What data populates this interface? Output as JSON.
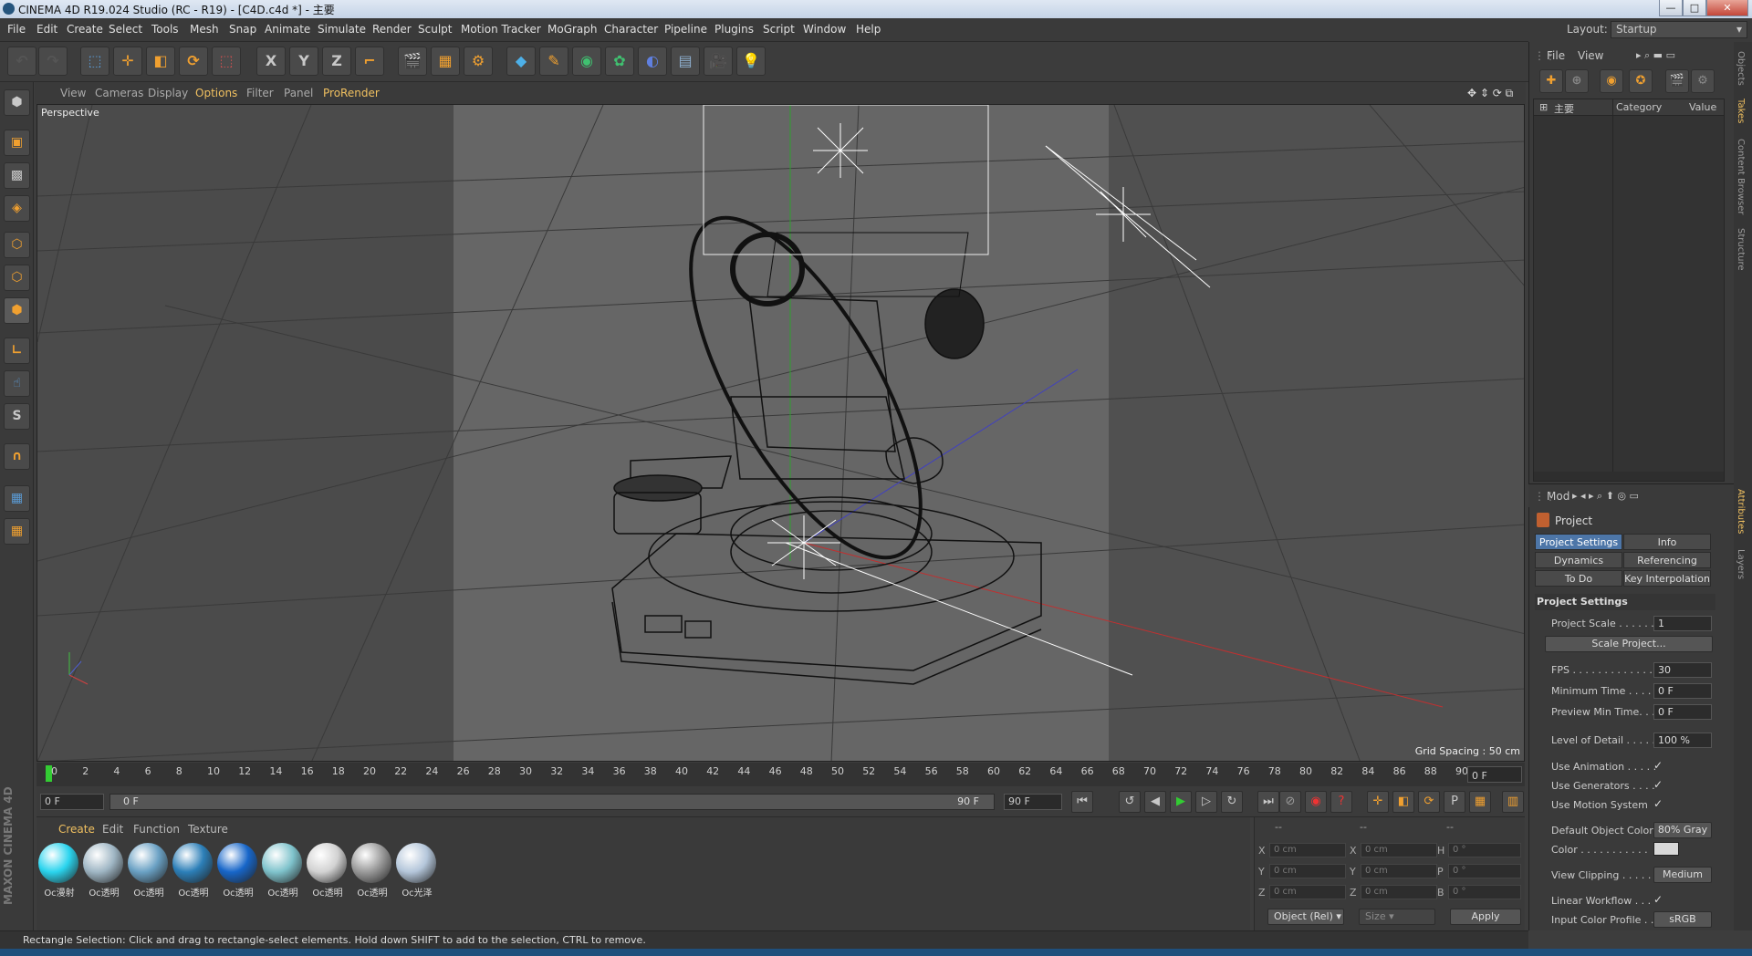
{
  "window": {
    "title": "CINEMA 4D R19.024 Studio (RC - R19) - [C4D.c4d *] - 主要",
    "controls": [
      "—",
      "□",
      "✕"
    ]
  },
  "menu": [
    "File",
    "Edit",
    "Create",
    "Select",
    "Tools",
    "Mesh",
    "Snap",
    "Animate",
    "Simulate",
    "Render",
    "Sculpt",
    "Motion Tracker",
    "MoGraph",
    "Character",
    "Pipeline",
    "Plugins",
    "Script",
    "Window",
    "Help"
  ],
  "layout": {
    "label": "Layout:",
    "value": "Startup"
  },
  "toolbar": {
    "axis_x": "X",
    "axis_y": "Y",
    "axis_z": "Z"
  },
  "viewport": {
    "menu": [
      "View",
      "Cameras",
      "Display",
      "Options",
      "Filter",
      "Panel",
      "ProRender"
    ],
    "camera_label": "Perspective",
    "grid_spacing": "Grid Spacing : 50 cm"
  },
  "timeline": {
    "ticks": [
      "0",
      "2",
      "4",
      "6",
      "8",
      "10",
      "12",
      "14",
      "16",
      "18",
      "20",
      "22",
      "24",
      "26",
      "28",
      "30",
      "32",
      "34",
      "36",
      "38",
      "40",
      "42",
      "44",
      "46",
      "48",
      "50",
      "52",
      "54",
      "56",
      "58",
      "60",
      "62",
      "64",
      "66",
      "68",
      "70",
      "72",
      "74",
      "76",
      "78",
      "80",
      "82",
      "84",
      "86",
      "88",
      "90"
    ],
    "current_frame": "0 F",
    "start_field": "0 F",
    "range_start": "0 F",
    "range_end": "90 F",
    "end_field": "90 F"
  },
  "materials": {
    "menu": [
      "Create",
      "Edit",
      "Function",
      "Texture"
    ],
    "items": [
      {
        "label": "Oc漫射",
        "color": "#2ad4ee"
      },
      {
        "label": "Oc透明",
        "color": "#9fb6c4"
      },
      {
        "label": "Oc透明",
        "color": "#6aa1c4"
      },
      {
        "label": "Oc透明",
        "color": "#2c7fb8"
      },
      {
        "label": "Oc透明",
        "color": "#1766c9"
      },
      {
        "label": "Oc透明",
        "color": "#7fc3cc"
      },
      {
        "label": "Oc透明",
        "color": "#d2d2d2"
      },
      {
        "label": "Oc透明",
        "color": "#9a9a9a"
      },
      {
        "label": "Oc光泽",
        "color": "#b4c6da"
      }
    ],
    "brand": "MAXON CINEMA 4D"
  },
  "coordinates": {
    "headers": [
      "--",
      "--",
      "--"
    ],
    "rows": [
      {
        "a": "X",
        "av": "0 cm",
        "b": "X",
        "bv": "0 cm",
        "c": "H",
        "cv": "0 °"
      },
      {
        "a": "Y",
        "av": "0 cm",
        "b": "Y",
        "bv": "0 cm",
        "c": "P",
        "cv": "0 °"
      },
      {
        "a": "Z",
        "av": "0 cm",
        "b": "Z",
        "bv": "0 cm",
        "c": "B",
        "cv": "0 °"
      }
    ],
    "mode": "Object (Rel)",
    "size_mode": "Size",
    "apply": "Apply"
  },
  "objects_panel": {
    "menu": [
      "File",
      "View"
    ],
    "columns": {
      "name": "主要",
      "category": "Category",
      "value": "Value"
    }
  },
  "attributes": {
    "mode": "Mod",
    "title": "Project",
    "tabs": [
      "Project Settings",
      "Info",
      "Dynamics",
      "Referencing",
      "To Do",
      "Key Interpolation"
    ],
    "section": "Project Settings",
    "project_scale": {
      "label": "Project Scale . . . . . .",
      "value": "1"
    },
    "scale_button": "Scale Project...",
    "fps": {
      "label": "FPS . . . . . . . . . . . . . .",
      "value": "30"
    },
    "min_time": {
      "label": "Minimum Time . . . . .",
      "value": "0 F"
    },
    "preview_min": {
      "label": "Preview Min Time. . .",
      "value": "0 F"
    },
    "lod": {
      "label": "Level of Detail . . . . .",
      "value": "100 %"
    },
    "use_animation": {
      "label": "Use Animation . . . . .",
      "value": "✓"
    },
    "use_generators": {
      "label": "Use Generators . . . .",
      "value": "✓"
    },
    "use_motion": {
      "label": "Use Motion System",
      "value": "✓"
    },
    "default_color": {
      "label": "Default Object Color",
      "value": "80% Gray"
    },
    "color": {
      "label": "Color . . . . . . . . . . ."
    },
    "view_clipping": {
      "label": "View Clipping . . . . .",
      "value": "Medium"
    },
    "linear_workflow": {
      "label": "Linear Workflow . . .",
      "value": "✓"
    },
    "input_profile": {
      "label": "Input Color Profile . .",
      "value": "sRGB"
    }
  },
  "side_tabs": [
    "Objects",
    "Takes",
    "Content Browser",
    "Structure",
    "Attributes",
    "Layers"
  ],
  "status": "Rectangle Selection: Click and drag to rectangle-select elements. Hold down SHIFT to add to the selection, CTRL to remove."
}
